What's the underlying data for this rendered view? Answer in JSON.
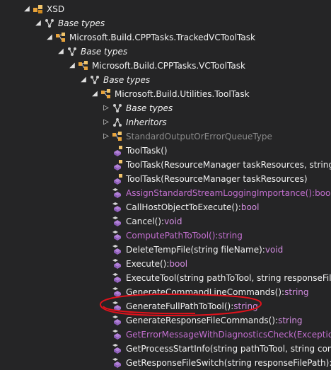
{
  "tree": [
    {
      "depth": 0,
      "arrow": "expanded",
      "icon": "assembly-icon",
      "label": "XSD",
      "style": "normal"
    },
    {
      "depth": 1,
      "arrow": "expanded",
      "icon": "base-types-icon",
      "label": "Base types",
      "style": "italic"
    },
    {
      "depth": 2,
      "arrow": "expanded",
      "icon": "class-icon",
      "label": "Microsoft.Build.CPPTasks.TrackedVCToolTask",
      "style": "normal"
    },
    {
      "depth": 3,
      "arrow": "expanded",
      "icon": "base-types-icon",
      "label": "Base types",
      "style": "italic"
    },
    {
      "depth": 4,
      "arrow": "expanded",
      "icon": "class-icon",
      "label": "Microsoft.Build.CPPTasks.VCToolTask",
      "style": "normal"
    },
    {
      "depth": 5,
      "arrow": "expanded",
      "icon": "base-types-icon",
      "label": "Base types",
      "style": "italic"
    },
    {
      "depth": 6,
      "arrow": "expanded",
      "icon": "class-icon",
      "label": "Microsoft.Build.Utilities.ToolTask",
      "style": "normal"
    },
    {
      "depth": 7,
      "arrow": "collapsed",
      "icon": "base-types-icon",
      "label": "Base types",
      "style": "italic"
    },
    {
      "depth": 7,
      "arrow": "collapsed",
      "icon": "inheritors-icon",
      "label": "Inheritors",
      "style": "italic"
    },
    {
      "depth": 7,
      "arrow": "collapsed",
      "icon": "class-icon",
      "label": "StandardOutputOrErrorQueueType",
      "style": "dim"
    },
    {
      "depth": 7,
      "arrow": "none",
      "icon": "constructor-icon",
      "label": "ToolTask()",
      "style": "normal"
    },
    {
      "depth": 7,
      "arrow": "none",
      "icon": "constructor-icon",
      "label": "ToolTask(ResourceManager taskResources, string help",
      "style": "normal"
    },
    {
      "depth": 7,
      "arrow": "none",
      "icon": "constructor-icon",
      "label": "ToolTask(ResourceManager taskResources)",
      "style": "normal"
    },
    {
      "depth": 7,
      "arrow": "none",
      "icon": "method-icon",
      "label": "AssignStandardStreamLoggingImportance():bool",
      "style": "inherited"
    },
    {
      "depth": 7,
      "arrow": "none",
      "icon": "method-icon",
      "label": "CallHostObjectToExecute():bool",
      "style": "normal"
    },
    {
      "depth": 7,
      "arrow": "none",
      "icon": "method-icon",
      "label": "Cancel():void",
      "style": "normal"
    },
    {
      "depth": 7,
      "arrow": "none",
      "icon": "method-icon",
      "label": "ComputePathToTool():string",
      "style": "inherited"
    },
    {
      "depth": 7,
      "arrow": "none",
      "icon": "method-icon",
      "label": "DeleteTempFile(string fileName):void",
      "style": "normal"
    },
    {
      "depth": 7,
      "arrow": "none",
      "icon": "method-icon",
      "label": "Execute():bool",
      "style": "normal"
    },
    {
      "depth": 7,
      "arrow": "none",
      "icon": "method-icon",
      "label": "ExecuteTool(string pathToTool, string responseFileCon",
      "style": "normal"
    },
    {
      "depth": 7,
      "arrow": "none",
      "icon": "method-icon",
      "label": "GenerateCommandLineCommands():string",
      "style": "normal"
    },
    {
      "depth": 7,
      "arrow": "none",
      "icon": "method-icon",
      "label": "GenerateFullPathToTool():string",
      "style": "normal"
    },
    {
      "depth": 7,
      "arrow": "none",
      "icon": "method-icon",
      "label": "GenerateResponseFileCommands():string",
      "style": "normal"
    },
    {
      "depth": 7,
      "arrow": "none",
      "icon": "method-icon",
      "label": "GetErrorMessageWithDiagnosticsCheck(Exception e):s",
      "style": "inherited"
    },
    {
      "depth": 7,
      "arrow": "none",
      "icon": "method-icon",
      "label": "GetProcessStartInfo(string pathToTool, string comman",
      "style": "normal"
    },
    {
      "depth": 7,
      "arrow": "none",
      "icon": "method-icon",
      "label": "GetResponseFileSwitch(string responseFilePath):string",
      "style": "normal"
    }
  ],
  "colors": {
    "background": "#252526",
    "text": "#f1f1f1",
    "inherited": "#c36fd0",
    "dim": "#8a8a8a",
    "annotation": "#e0121c"
  },
  "annotation": {
    "target": "GenerateFullPathToTool():string",
    "shape": "hand-drawn red ellipse"
  }
}
